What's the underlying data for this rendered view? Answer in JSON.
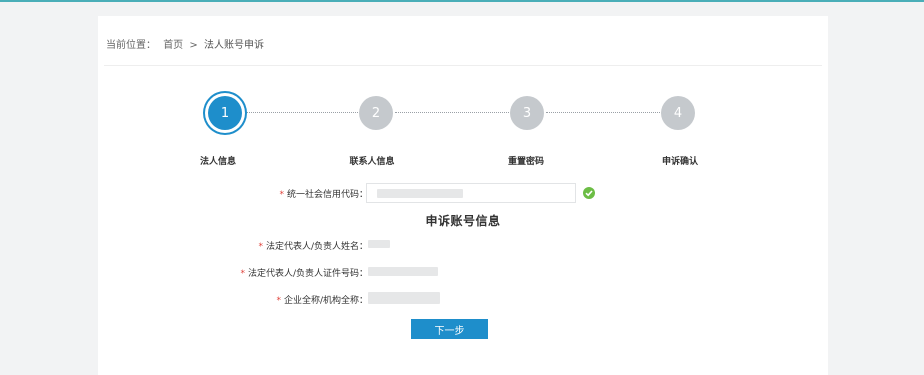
{
  "breadcrumb": {
    "prefix": "当前位置：",
    "home": "首页",
    "separator": ">",
    "current": "法人账号申诉"
  },
  "steps": [
    {
      "number": "1",
      "label": "法人信息",
      "active": true
    },
    {
      "number": "2",
      "label": "联系人信息",
      "active": false
    },
    {
      "number": "3",
      "label": "重置密码",
      "active": false
    },
    {
      "number": "4",
      "label": "申诉确认",
      "active": false
    }
  ],
  "form": {
    "credit_code": {
      "required_mark": "*",
      "label": "统一社会信用代码：",
      "status": "valid"
    },
    "section_title": "申诉账号信息",
    "rep_name": {
      "required_mark": "*",
      "label": "法定代表人/负责人姓名："
    },
    "rep_id": {
      "required_mark": "*",
      "label": "法定代表人/负责人证件号码："
    },
    "org_name": {
      "required_mark": "*",
      "label": "企业全称/机构全称："
    }
  },
  "next_button": "下一步",
  "colors": {
    "accent": "#1e8ecb",
    "inactive_step": "#c5c9cd",
    "required": "#e0423a",
    "valid": "#6cbd45"
  }
}
